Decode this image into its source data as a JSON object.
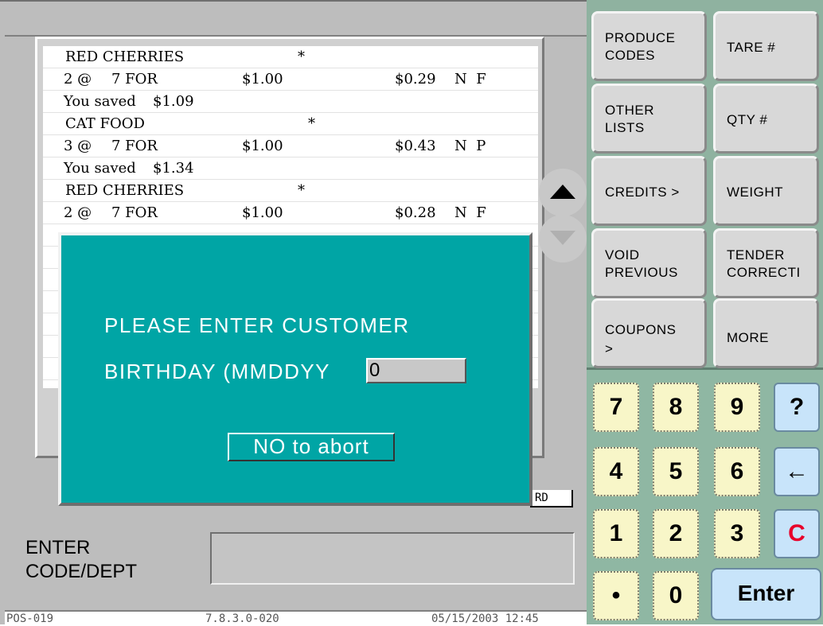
{
  "receipt": {
    "lines": [
      {
        "name": "RED CHERRIES",
        "flag": "*"
      },
      {
        "qty": "2 @",
        "deal": "7 FOR",
        "deal_price": "$1.00",
        "price": "$0.29",
        "codes": "N  F"
      },
      {
        "saved_label": "You saved",
        "saved_amount": "$1.09"
      },
      {
        "name": "CAT FOOD",
        "flag": "*"
      },
      {
        "qty": "3 @",
        "deal": "7 FOR",
        "deal_price": "$1.00",
        "price": "$0.43",
        "codes": "N  P"
      },
      {
        "saved_label": "You saved",
        "saved_amount": "$1.34"
      },
      {
        "name": "RED CHERRIES",
        "flag": "*"
      },
      {
        "qty": "2 @",
        "deal": "7 FOR",
        "deal_price": "$1.00",
        "price": "$0.28",
        "codes": "N  F"
      }
    ]
  },
  "rd_tag": "RD",
  "entry": {
    "label_line1": "ENTER",
    "label_line2": "CODE/DEPT",
    "value": ""
  },
  "status": {
    "terminal": "POS-019",
    "version": "7.8.3.0-020",
    "datetime": "05/15/2003 12:45"
  },
  "modal": {
    "line1": "PLEASE ENTER CUSTOMER",
    "line2": "BIRTHDAY (MMDDYY",
    "input_value": "0",
    "abort_label": "NO to abort"
  },
  "functions": {
    "produce_codes": [
      "PRODUCE",
      "CODES"
    ],
    "tare": "TARE #",
    "other_lists": [
      "OTHER",
      "LISTS"
    ],
    "qty": "QTY #",
    "credits": "CREDITS >",
    "weight": "WEIGHT",
    "void_previous": [
      "VOID",
      "PREVIOUS"
    ],
    "tender_correction": [
      "TENDER",
      "CORRECTI"
    ],
    "coupons": [
      "COUPONS",
      ">"
    ],
    "more": "MORE"
  },
  "keypad": {
    "k7": "7",
    "k8": "8",
    "k9": "9",
    "help": "?",
    "k4": "4",
    "k5": "5",
    "k6": "6",
    "back": "←",
    "k1": "1",
    "k2": "2",
    "k3": "3",
    "clear": "C",
    "dot": "•",
    "k0": "0",
    "enter": "Enter"
  },
  "colors": {
    "modal_bg": "#00a5a5",
    "right_panel_bg": "#8fb7a3",
    "key_bg": "#f8f6c8",
    "key_blue": "#c8e4fa",
    "clear_red": "#e8002a"
  }
}
